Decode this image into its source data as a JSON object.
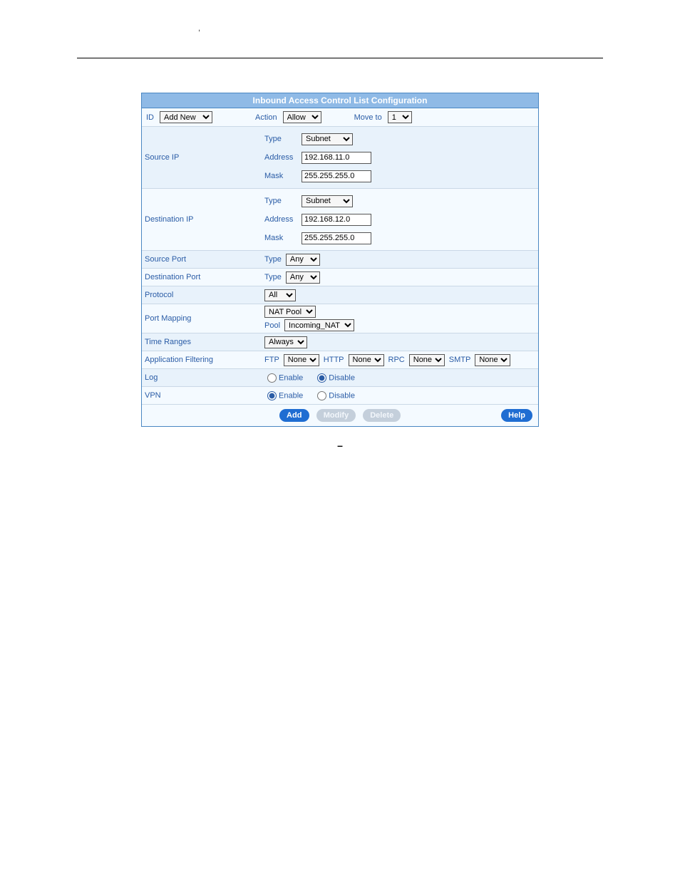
{
  "panel_title": "Inbound Access Control List Configuration",
  "top": {
    "id_lbl": "ID",
    "id_sel": "Add New",
    "action_lbl": "Action",
    "action_sel": "Allow",
    "move_lbl": "Move to",
    "move_sel": "1"
  },
  "rows": {
    "srcip": {
      "label": "Source IP",
      "type_lbl": "Type",
      "type_val": "Subnet",
      "addr_lbl": "Address",
      "addr_val": "192.168.11.0",
      "mask_lbl": "Mask",
      "mask_val": "255.255.255.0"
    },
    "dstip": {
      "label": "Destination IP",
      "type_lbl": "Type",
      "type_val": "Subnet",
      "addr_lbl": "Address",
      "addr_val": "192.168.12.0",
      "mask_lbl": "Mask",
      "mask_val": "255.255.255.0"
    },
    "srcport": {
      "label": "Source Port",
      "type_lbl": "Type",
      "type_val": "Any"
    },
    "dstport": {
      "label": "Destination Port",
      "type_lbl": "Type",
      "type_val": "Any"
    },
    "proto": {
      "label": "Protocol",
      "val": "All"
    },
    "pmap": {
      "label": "Port Mapping",
      "sel1": "NAT Pool",
      "pool_lbl": "Pool",
      "sel2": "Incoming_NAT"
    },
    "time": {
      "label": "Time Ranges",
      "val": "Always"
    },
    "appf": {
      "label": "Application Filtering",
      "ftp_lbl": "FTP",
      "ftp_val": "None",
      "http_lbl": "HTTP",
      "http_val": "None",
      "rpc_lbl": "RPC",
      "rpc_val": "None",
      "smtp_lbl": "SMTP",
      "smtp_val": "None"
    },
    "log": {
      "label": "Log",
      "enable": "Enable",
      "disable": "Disable",
      "selected": "disable"
    },
    "vpn": {
      "label": "VPN",
      "enable": "Enable",
      "disable": "Disable",
      "selected": "enable"
    }
  },
  "buttons": {
    "add": "Add",
    "modify": "Modify",
    "delete": "Delete",
    "help": "Help"
  },
  "caption_dash": "–"
}
